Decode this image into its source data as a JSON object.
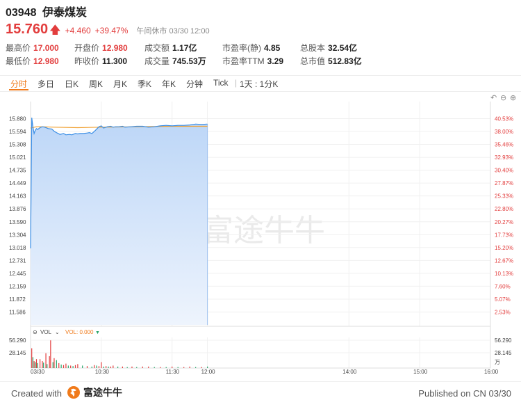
{
  "header": {
    "code": "03948",
    "name": "伊泰煤炭"
  },
  "quote": {
    "price": "15.760",
    "change": "+4.460",
    "change_pct": "+39.47%",
    "status": "午间休市 03/30 12:00"
  },
  "stats": [
    {
      "label": "最高价",
      "value": "17.000",
      "red": true
    },
    {
      "label": "开盘价",
      "value": "12.980",
      "red": true
    },
    {
      "label": "成交额",
      "value": "1.17亿",
      "red": false
    },
    {
      "label": "市盈率(静)",
      "value": "4.85",
      "red": false
    },
    {
      "label": "总股本",
      "value": "32.54亿",
      "red": false
    },
    {
      "label": "最低价",
      "value": "12.980",
      "red": true
    },
    {
      "label": "昨收价",
      "value": "11.300",
      "red": false
    },
    {
      "label": "成交量",
      "value": "745.53万",
      "red": false
    },
    {
      "label": "市盈率TTM",
      "value": "3.29",
      "red": false
    },
    {
      "label": "总市值",
      "value": "512.83亿",
      "red": false
    }
  ],
  "tabs": [
    "分时",
    "多日",
    "日K",
    "周K",
    "月K",
    "季K",
    "年K",
    "分钟",
    "Tick"
  ],
  "active_tab": "分时",
  "interval": "1天 : 1分K",
  "toolbar": {
    "undo": "↶",
    "zoom_out": "⊖",
    "zoom_in": "⊕"
  },
  "volume": {
    "label": "VOL",
    "value_label": "VOL: 0.000",
    "unit": "万"
  },
  "colors": {
    "accent": "#f07a1a",
    "up": "#e23d3d",
    "down": "#2aa66b",
    "line": "#3a8ee6",
    "avg": "#f0a030"
  },
  "watermark": "富途牛牛",
  "footer": {
    "created": "Created with",
    "brand": "富途牛牛",
    "published": "Published on CN 03/30"
  },
  "chart_data": {
    "type": "line",
    "price_axis": [
      "15.880",
      "15.594",
      "15.308",
      "15.021",
      "14.735",
      "14.449",
      "14.163",
      "13.876",
      "13.590",
      "13.304",
      "13.018",
      "12.731",
      "12.445",
      "12.159",
      "11.872",
      "11.586"
    ],
    "pct_axis": [
      "40.53%",
      "38.00%",
      "35.46%",
      "32.93%",
      "30.40%",
      "27.87%",
      "25.33%",
      "22.80%",
      "20.27%",
      "17.73%",
      "15.20%",
      "12.67%",
      "10.13%",
      "7.60%",
      "5.07%",
      "2.53%"
    ],
    "ylim": [
      11.3,
      16.166
    ],
    "x_ticks": [
      "03/30",
      "10:30",
      "11:30",
      "12:00",
      "14:00",
      "15:00",
      "16:00"
    ],
    "x_tick_minutes": [
      0,
      60,
      120,
      150,
      270,
      330,
      390
    ],
    "price_minutes": [
      0,
      1,
      2,
      3,
      4,
      5,
      6,
      8,
      10,
      12,
      15,
      18,
      20,
      22,
      25,
      28,
      30,
      33,
      35,
      38,
      40,
      42,
      45,
      48,
      50,
      52,
      55,
      58,
      60,
      62,
      65,
      68,
      70,
      72,
      75,
      78,
      80,
      85,
      90,
      95,
      100,
      105,
      110,
      115,
      120,
      125,
      130,
      135,
      140,
      145,
      150
    ],
    "price": [
      13.0,
      15.9,
      15.7,
      15.55,
      15.62,
      15.66,
      15.64,
      15.68,
      15.7,
      15.69,
      15.66,
      15.65,
      15.6,
      15.57,
      15.53,
      15.55,
      15.52,
      15.53,
      15.52,
      15.55,
      15.54,
      15.55,
      15.55,
      15.56,
      15.57,
      15.55,
      15.62,
      15.7,
      15.72,
      15.67,
      15.7,
      15.71,
      15.69,
      15.7,
      15.7,
      15.71,
      15.69,
      15.7,
      15.71,
      15.71,
      15.69,
      15.7,
      15.72,
      15.73,
      15.72,
      15.73,
      15.73,
      15.74,
      15.76,
      15.75,
      15.76
    ],
    "avg_minutes": [
      0,
      5,
      10,
      20,
      40,
      60,
      90,
      120,
      150
    ],
    "avg": [
      15.67,
      15.7,
      15.7,
      15.69,
      15.68,
      15.69,
      15.7,
      15.71,
      15.71
    ],
    "volume_axis": [
      "56.290",
      "28.145"
    ],
    "volume_max": 56.29,
    "volume_minutes": [
      1,
      2,
      3,
      4,
      5,
      6,
      8,
      10,
      11,
      13,
      14,
      16,
      17,
      19,
      20,
      22,
      24,
      26,
      28,
      30,
      32,
      34,
      36,
      38,
      40,
      44,
      48,
      52,
      54,
      56,
      58,
      60,
      62,
      64,
      66,
      68,
      70,
      74,
      78,
      82,
      86,
      90,
      95,
      100,
      105,
      110,
      115,
      120,
      125,
      130,
      135,
      140,
      145,
      150
    ],
    "volume": [
      40,
      22,
      14,
      12,
      18,
      10,
      18,
      14,
      11,
      30,
      8,
      24,
      56,
      12,
      20,
      16,
      10,
      7,
      6,
      9,
      5,
      5,
      4,
      6,
      8,
      5,
      4,
      3,
      6,
      5,
      4,
      12,
      3,
      4,
      3,
      3,
      5,
      3,
      3,
      2,
      3,
      2,
      3,
      3,
      2,
      2,
      2,
      3,
      2,
      2,
      3,
      2,
      2,
      3
    ],
    "volume_up": [
      true,
      false,
      true,
      false,
      true,
      false,
      true,
      true,
      false,
      true,
      false,
      true,
      true,
      false,
      true,
      false,
      true,
      false,
      true,
      true,
      false,
      true,
      false,
      true,
      true,
      false,
      true,
      false,
      true,
      false,
      true,
      true,
      false,
      true,
      false,
      true,
      true,
      false,
      true,
      false,
      true,
      false,
      true,
      true,
      false,
      true,
      false,
      true,
      false,
      true,
      true,
      false,
      true,
      false
    ]
  }
}
